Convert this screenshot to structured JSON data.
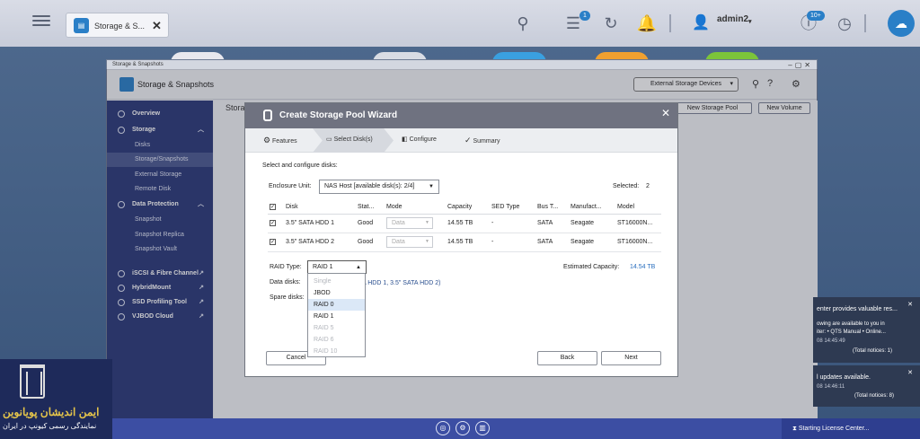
{
  "desktop": {
    "tab_label": "Storage & S...",
    "user_name": "admin2",
    "badge_1": "1",
    "badge_10": "10+"
  },
  "window": {
    "title_small": "Storage & Snapshots",
    "title": "Storage & Snapshots",
    "external_storage_label": "External Storage Devices",
    "content_title": "Storag",
    "new_storage_pool_label": "New Storage Pool",
    "new_volume_label": "New Volume"
  },
  "sidebar": {
    "overview": "Overview",
    "storage": "Storage",
    "disks": "Disks",
    "storage_snapshots": "Storage/Snapshots",
    "external_storage": "External Storage",
    "remote_disk": "Remote Disk",
    "data_protection": "Data Protection",
    "snapshot": "Snapshot",
    "snapshot_replica": "Snapshot Replica",
    "snapshot_vault": "Snapshot Vault",
    "iscsi": "iSCSI & Fibre Channel",
    "hybridmount": "HybridMount",
    "ssd_profiling": "SSD Profiling Tool",
    "vjbod": "VJBOD Cloud"
  },
  "wizard": {
    "title": "Create Storage Pool Wizard",
    "steps": [
      "Features",
      "Select Disk(s)",
      "Configure",
      "Summary"
    ],
    "instruction": "Select and configure disks:",
    "enclosure_label": "Enclosure Unit:",
    "enclosure_value": "NAS Host [available disk(s): 2/4]",
    "selected_label": "Selected:",
    "selected_value": "2",
    "columns": [
      "Disk",
      "Stat...",
      "Mode",
      "Capacity",
      "SED Type",
      "Bus T...",
      "Manufact...",
      "Model"
    ],
    "rows": [
      {
        "disk": "3.5\" SATA HDD 1",
        "status": "Good",
        "mode": "Data",
        "capacity": "14.55 TB",
        "sed": "-",
        "bus": "SATA",
        "manufacturer": "Seagate",
        "model": "ST16000N..."
      },
      {
        "disk": "3.5\" SATA HDD 2",
        "status": "Good",
        "mode": "Data",
        "capacity": "14.55 TB",
        "sed": "-",
        "bus": "SATA",
        "manufacturer": "Seagate",
        "model": "ST16000N..."
      }
    ],
    "raid_label": "RAID Type:",
    "raid_value": "RAID 1",
    "estimated_label": "Estimated Capacity:",
    "estimated_value": "14.54 TB",
    "data_disks_label": "Data disks:",
    "data_disks_value": "A HDD 1, 3.5\" SATA HDD 2)",
    "spare_disks_label": "Spare disks:",
    "raid_options": [
      "Single",
      "JBOD",
      "RAID 0",
      "RAID 1",
      "RAID 5",
      "RAID 6",
      "RAID 10"
    ],
    "cancel_label": "Cancel",
    "back_label": "Back",
    "next_label": "Next"
  },
  "notifications": {
    "n1_title": "enter provides valuable res...",
    "n1_l1": "owing are available to you in",
    "n1_l2": "iter: • QTS Manual • Online...",
    "n1_time": "08 14:45:49",
    "n1_total": "(Total notices: 1)",
    "n2_title": "l updates available.",
    "n2_time": "08 14:46:11",
    "n2_total": "(Total notices: 8)"
  },
  "taskbar": {
    "license_text": "Starting License Center..."
  },
  "brand": {
    "line1": "ایمن اندیشان پویانوین",
    "line2": "نمایندگی رسمی کیونپ در ایران"
  }
}
